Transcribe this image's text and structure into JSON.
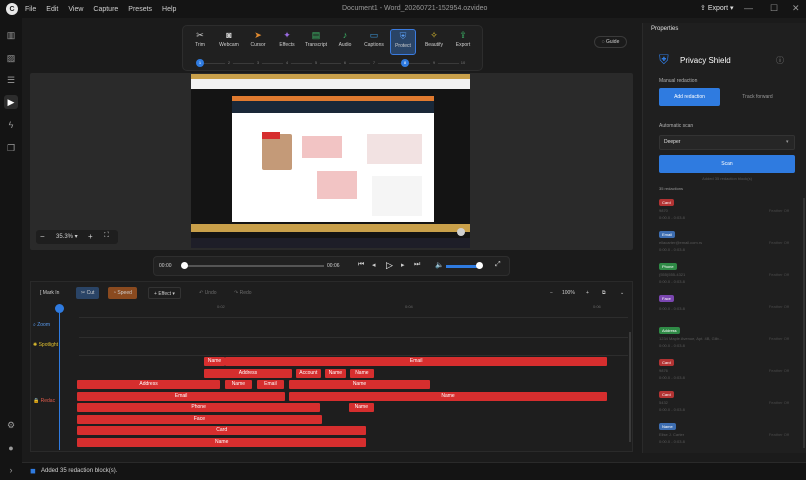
{
  "app": {
    "title": "Document1 - Word_20260721-152954.ozvideo",
    "menu": [
      "File",
      "Edit",
      "View",
      "Capture",
      "Presets",
      "Help"
    ],
    "export_label": "Export",
    "logo_glyph": "C"
  },
  "toolbar": {
    "tools": [
      "Trim",
      "Webcam",
      "Cursor",
      "Effects",
      "Transcript",
      "Audio",
      "Captions",
      "Protect",
      "Beautify",
      "Export"
    ],
    "steps": [
      "1",
      "2",
      "3",
      "4",
      "5",
      "6",
      "7",
      "8",
      "9",
      "10"
    ],
    "active_index": 7,
    "guide_label": "Guide"
  },
  "preview": {
    "zoom": "35.3%",
    "time_current": "00:00",
    "time_total": "00:06"
  },
  "timeline": {
    "mark_in": "[ Mark In",
    "cut": "Cut",
    "speed": "Speed",
    "effect": "Effect",
    "undo": "Undo",
    "redo": "Redo",
    "zoom_pct": "100%",
    "ticks": [
      "0:02",
      "0:04",
      "0:06"
    ],
    "tracks": [
      "Zoom",
      "Spotlight",
      "Redac"
    ],
    "bars": [
      {
        "label": "Name",
        "row": 0,
        "start": 0.239,
        "end": 0.28
      },
      {
        "label": "Email",
        "row": 0,
        "start": 0.28,
        "end": 1.0
      },
      {
        "label": "Address",
        "row": 1,
        "start": 0.239,
        "end": 0.406
      },
      {
        "label": "Account",
        "row": 1,
        "start": 0.413,
        "end": 0.46
      },
      {
        "label": "Name",
        "row": 1,
        "start": 0.467,
        "end": 0.508
      },
      {
        "label": "Name",
        "row": 1,
        "start": 0.515,
        "end": 0.56
      },
      {
        "label": "Address",
        "row": 2,
        "start": 0.0,
        "end": 0.27
      },
      {
        "label": "Name",
        "row": 2,
        "start": 0.279,
        "end": 0.33
      },
      {
        "label": "Email",
        "row": 2,
        "start": 0.34,
        "end": 0.39
      },
      {
        "label": "Name",
        "row": 2,
        "start": 0.4,
        "end": 0.666
      },
      {
        "label": "Email",
        "row": 3,
        "start": 0.0,
        "end": 0.393
      },
      {
        "label": "Name",
        "row": 3,
        "start": 0.4,
        "end": 1.0
      },
      {
        "label": "Phone",
        "row": 4,
        "start": 0.0,
        "end": 0.459
      },
      {
        "label": "Name",
        "row": 4,
        "start": 0.513,
        "end": 0.56
      },
      {
        "label": "Face",
        "row": 5,
        "start": 0.0,
        "end": 0.462
      },
      {
        "label": "Card",
        "row": 6,
        "start": 0.0,
        "end": 0.546
      },
      {
        "label": "Name",
        "row": 7,
        "start": 0.0,
        "end": 0.546
      }
    ]
  },
  "properties": {
    "header": "Properties",
    "title": "Privacy Shield",
    "manual_label": "Manual redaction",
    "add_redaction": "Add redaction",
    "track_forward": "Track forward",
    "auto_label": "Automatic scan",
    "scan_mode": "Deeper",
    "scan_button": "Scan",
    "scan_note": "Added 35 redaction block(s)",
    "count_label": "35 redactions",
    "items": [
      {
        "tag": "Card",
        "color": "#b33333",
        "sub": "9870",
        "time": "0:00.0 - 0:03.8"
      },
      {
        "tag": "Email",
        "color": "#3d6db0",
        "sub": "ellacarter@email.com.rs",
        "time": "0:00.0 - 0:03.8"
      },
      {
        "tag": "Phone",
        "color": "#2f8a46",
        "sub": "(555)555-4321",
        "time": "0:00.0 - 0:03.8"
      },
      {
        "tag": "Face",
        "color": "#7a46b0",
        "sub": "",
        "time": "0:00.0 - 0:03.8"
      },
      {
        "tag": "Address",
        "color": "#2f8a46",
        "sub": "1234 Maple Avenue, Apt. 4B, Gilb...",
        "time": "0:00.0 - 0:03.8"
      },
      {
        "tag": "Card",
        "color": "#b33333",
        "sub": "9876",
        "time": "0:00.0 - 0:03.8"
      },
      {
        "tag": "Card",
        "color": "#b33333",
        "sub": "5432",
        "time": "0:00.0 - 0:03.8"
      },
      {
        "tag": "Name",
        "color": "#3d6db0",
        "sub": "Elise J. Carter",
        "time": "0:00.0 - 0:03.8"
      }
    ],
    "item_ops": "Feather   Off"
  },
  "status": {
    "message": "Added 35 redaction block(s)."
  }
}
